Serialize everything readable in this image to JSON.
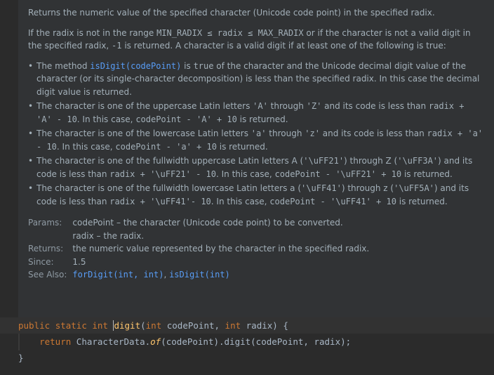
{
  "doc": {
    "summary": "Returns the numeric value of the specified character (Unicode code point) in the specified radix.",
    "intro": {
      "t1": "If the radix is not in the range ",
      "c1": "MIN_RADIX ≤ radix ≤ MAX_RADIX",
      "t2": " or if the character is not a valid digit in the specified radix, ",
      "c2": "-1",
      "t3": " is returned. A character is a valid digit if at least one of the following is true:"
    },
    "bullets": [
      {
        "t1": "The method ",
        "l1": "isDigit(codePoint)",
        "t2": " is ",
        "c1": "true",
        "t3": " of the character and the Unicode decimal digit value of the character (or its single-character decomposition) is less than the specified radix. In this case the decimal digit value is returned."
      },
      {
        "t1": "The character is one of the uppercase Latin letters ",
        "c1": "'A'",
        "t2": " through ",
        "c2": "'Z'",
        "t3": " and its code is less than ",
        "c3": "radix + 'A' - 10",
        "t4": ". In this case, ",
        "c4": "codePoint - 'A' + 10",
        "t5": " is returned."
      },
      {
        "t1": "The character is one of the lowercase Latin letters ",
        "c1": "'a'",
        "t2": " through ",
        "c2": "'z'",
        "t3": " and its code is less than ",
        "c3": "radix + 'a' - 10",
        "t4": ". In this case, ",
        "c4": "codePoint - 'a' + 10",
        "t5": " is returned."
      },
      {
        "t1": "The character is one of the fullwidth uppercase Latin letters A (",
        "c1": "'\\uFF21'",
        "t2": ") through Z (",
        "c2": "'\\uFF3A'",
        "t3": ") and its code is less than ",
        "c3": "radix + '\\uFF21' - 10",
        "t4": ". In this case, ",
        "c4": "codePoint - '\\uFF21' + 10",
        "t5": " is returned."
      },
      {
        "t1": "The character is one of the fullwidth lowercase Latin letters a (",
        "c1": "'\\uFF41'",
        "t2": ") through z (",
        "c2": "'\\uFF5A'",
        "t3": ") and its code is less than ",
        "c3": "radix + '\\uFF41'- 10",
        "t4": ". In this case, ",
        "c4": "codePoint - '\\uFF41' + 10",
        "t5": " is returned."
      }
    ],
    "tags": {
      "params_label": "Params:",
      "param1": "codePoint – the character (Unicode code point) to be converted.",
      "param2": "radix – the radix.",
      "returns_label": "Returns:",
      "returns": "the numeric value represented by the character in the specified radix.",
      "since_label": "Since:",
      "since": "1.5",
      "see_label": "See Also:",
      "see1": "forDigit(int, int)",
      "see_sep": ", ",
      "see2": "isDigit(int)"
    }
  },
  "code": {
    "l1_kw1": "public",
    "l1_kw2": "static",
    "l1_kw3": "int",
    "l1_name": "digit",
    "l1_p1": "(",
    "l1_kw4": "int",
    "l1_p2": " codePoint, ",
    "l1_kw5": "int",
    "l1_p3": " radix) {",
    "l2_kw": "return",
    "l2_cls": " CharacterData.",
    "l2_of": "of",
    "l2_rest": "(codePoint).digit(codePoint, radix);",
    "l3": "}"
  }
}
